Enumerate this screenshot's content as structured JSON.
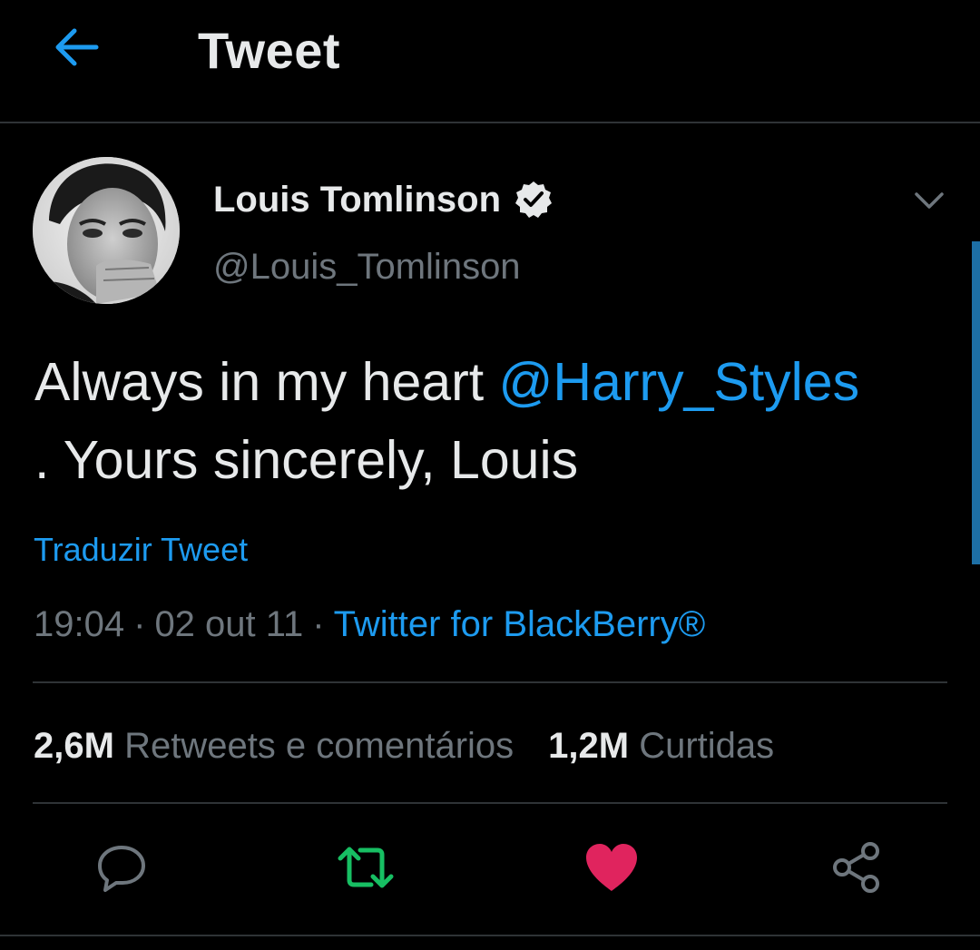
{
  "header": {
    "title": "Tweet",
    "back_icon": "arrow-left-icon"
  },
  "author": {
    "name": "Louis Tomlinson",
    "handle": "@Louis_Tomlinson",
    "verified": true,
    "verified_icon": "verified-badge-icon"
  },
  "tweet": {
    "text_before": "Always in my heart ",
    "mention": "@Harry_Styles",
    "text_after": " . Yours sincerely, Louis",
    "translate_label": "Traduzir Tweet",
    "time": "19:04",
    "separator": "·",
    "date": "02 out 11",
    "client": "Twitter for BlackBerry®"
  },
  "stats": {
    "retweets_count": "2,6M",
    "retweets_label": "Retweets e comentários",
    "likes_count": "1,2M",
    "likes_label": "Curtidas"
  },
  "actions": [
    {
      "name": "reply",
      "icon": "comment-icon"
    },
    {
      "name": "retweet",
      "icon": "retweet-icon"
    },
    {
      "name": "like",
      "icon": "heart-icon"
    },
    {
      "name": "share",
      "icon": "share-icon"
    }
  ],
  "colors": {
    "background": "#000000",
    "accent": "#1d9bf0",
    "retweet_active": "#17bf63",
    "like_active": "#e0245e",
    "secondary_text": "#6e767d",
    "divider": "#2f3336"
  }
}
